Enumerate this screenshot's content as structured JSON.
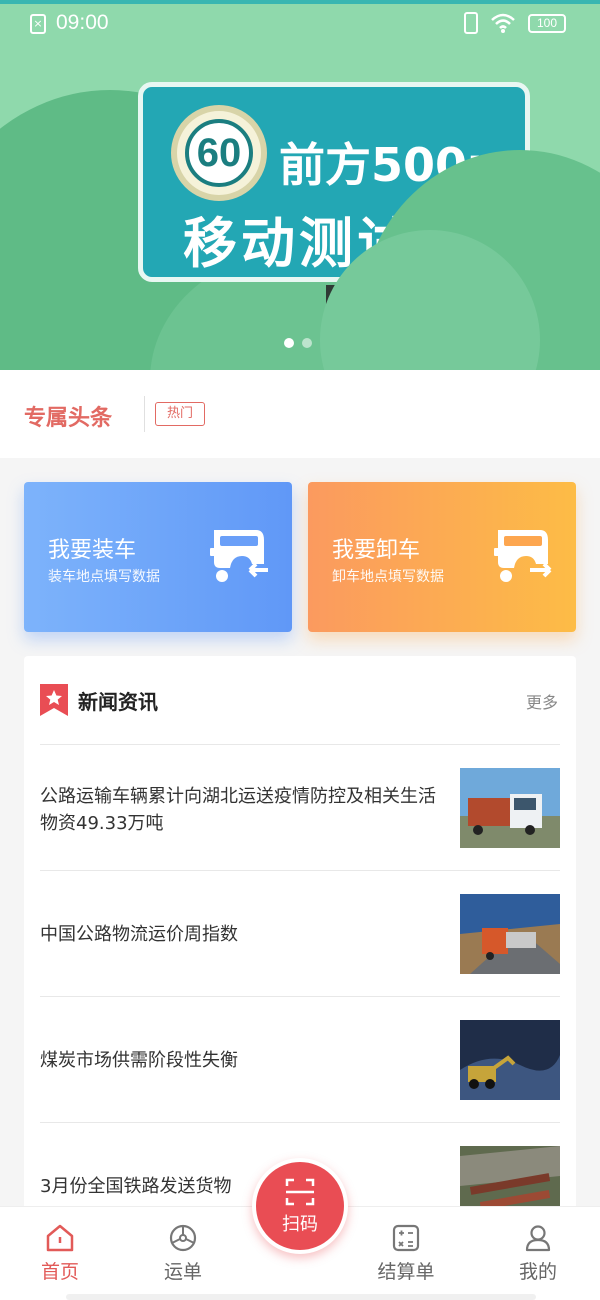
{
  "status_bar": {
    "time": "09:00",
    "battery": "100"
  },
  "banner": {
    "speed_limit": "60",
    "sign_line1": "前方500m",
    "sign_line2": "移动测试",
    "slides": [
      {
        "active": true
      },
      {
        "active": false
      }
    ]
  },
  "headline": {
    "title": "专属头条",
    "tag": "热门"
  },
  "actions": {
    "load": {
      "title": "我要装车",
      "subtitle": "装车地点填写数据",
      "color": "#6a9ff8"
    },
    "unload": {
      "title": "我要卸车",
      "subtitle": "卸车地点填写数据",
      "color": "#fda64f"
    }
  },
  "news": {
    "title": "新闻资讯",
    "more": "更多",
    "items": [
      {
        "text": "公路运输车辆累计向湖北运送疫情防控及相关生活物资49.33万吨",
        "thumb": "truck-photo"
      },
      {
        "text": "中国公路物流运价周指数",
        "thumb": "highway-truck-photo"
      },
      {
        "text": "煤炭市场供需阶段性失衡",
        "thumb": "coal-loader-photo"
      },
      {
        "text": "3月份全国铁路发送货物",
        "thumb": "railway-photo"
      }
    ]
  },
  "tabbar": {
    "home": "首页",
    "waybill": "运单",
    "scan": "扫码",
    "settlement": "结算单",
    "mine": "我的",
    "active_color": "#e25a58"
  }
}
